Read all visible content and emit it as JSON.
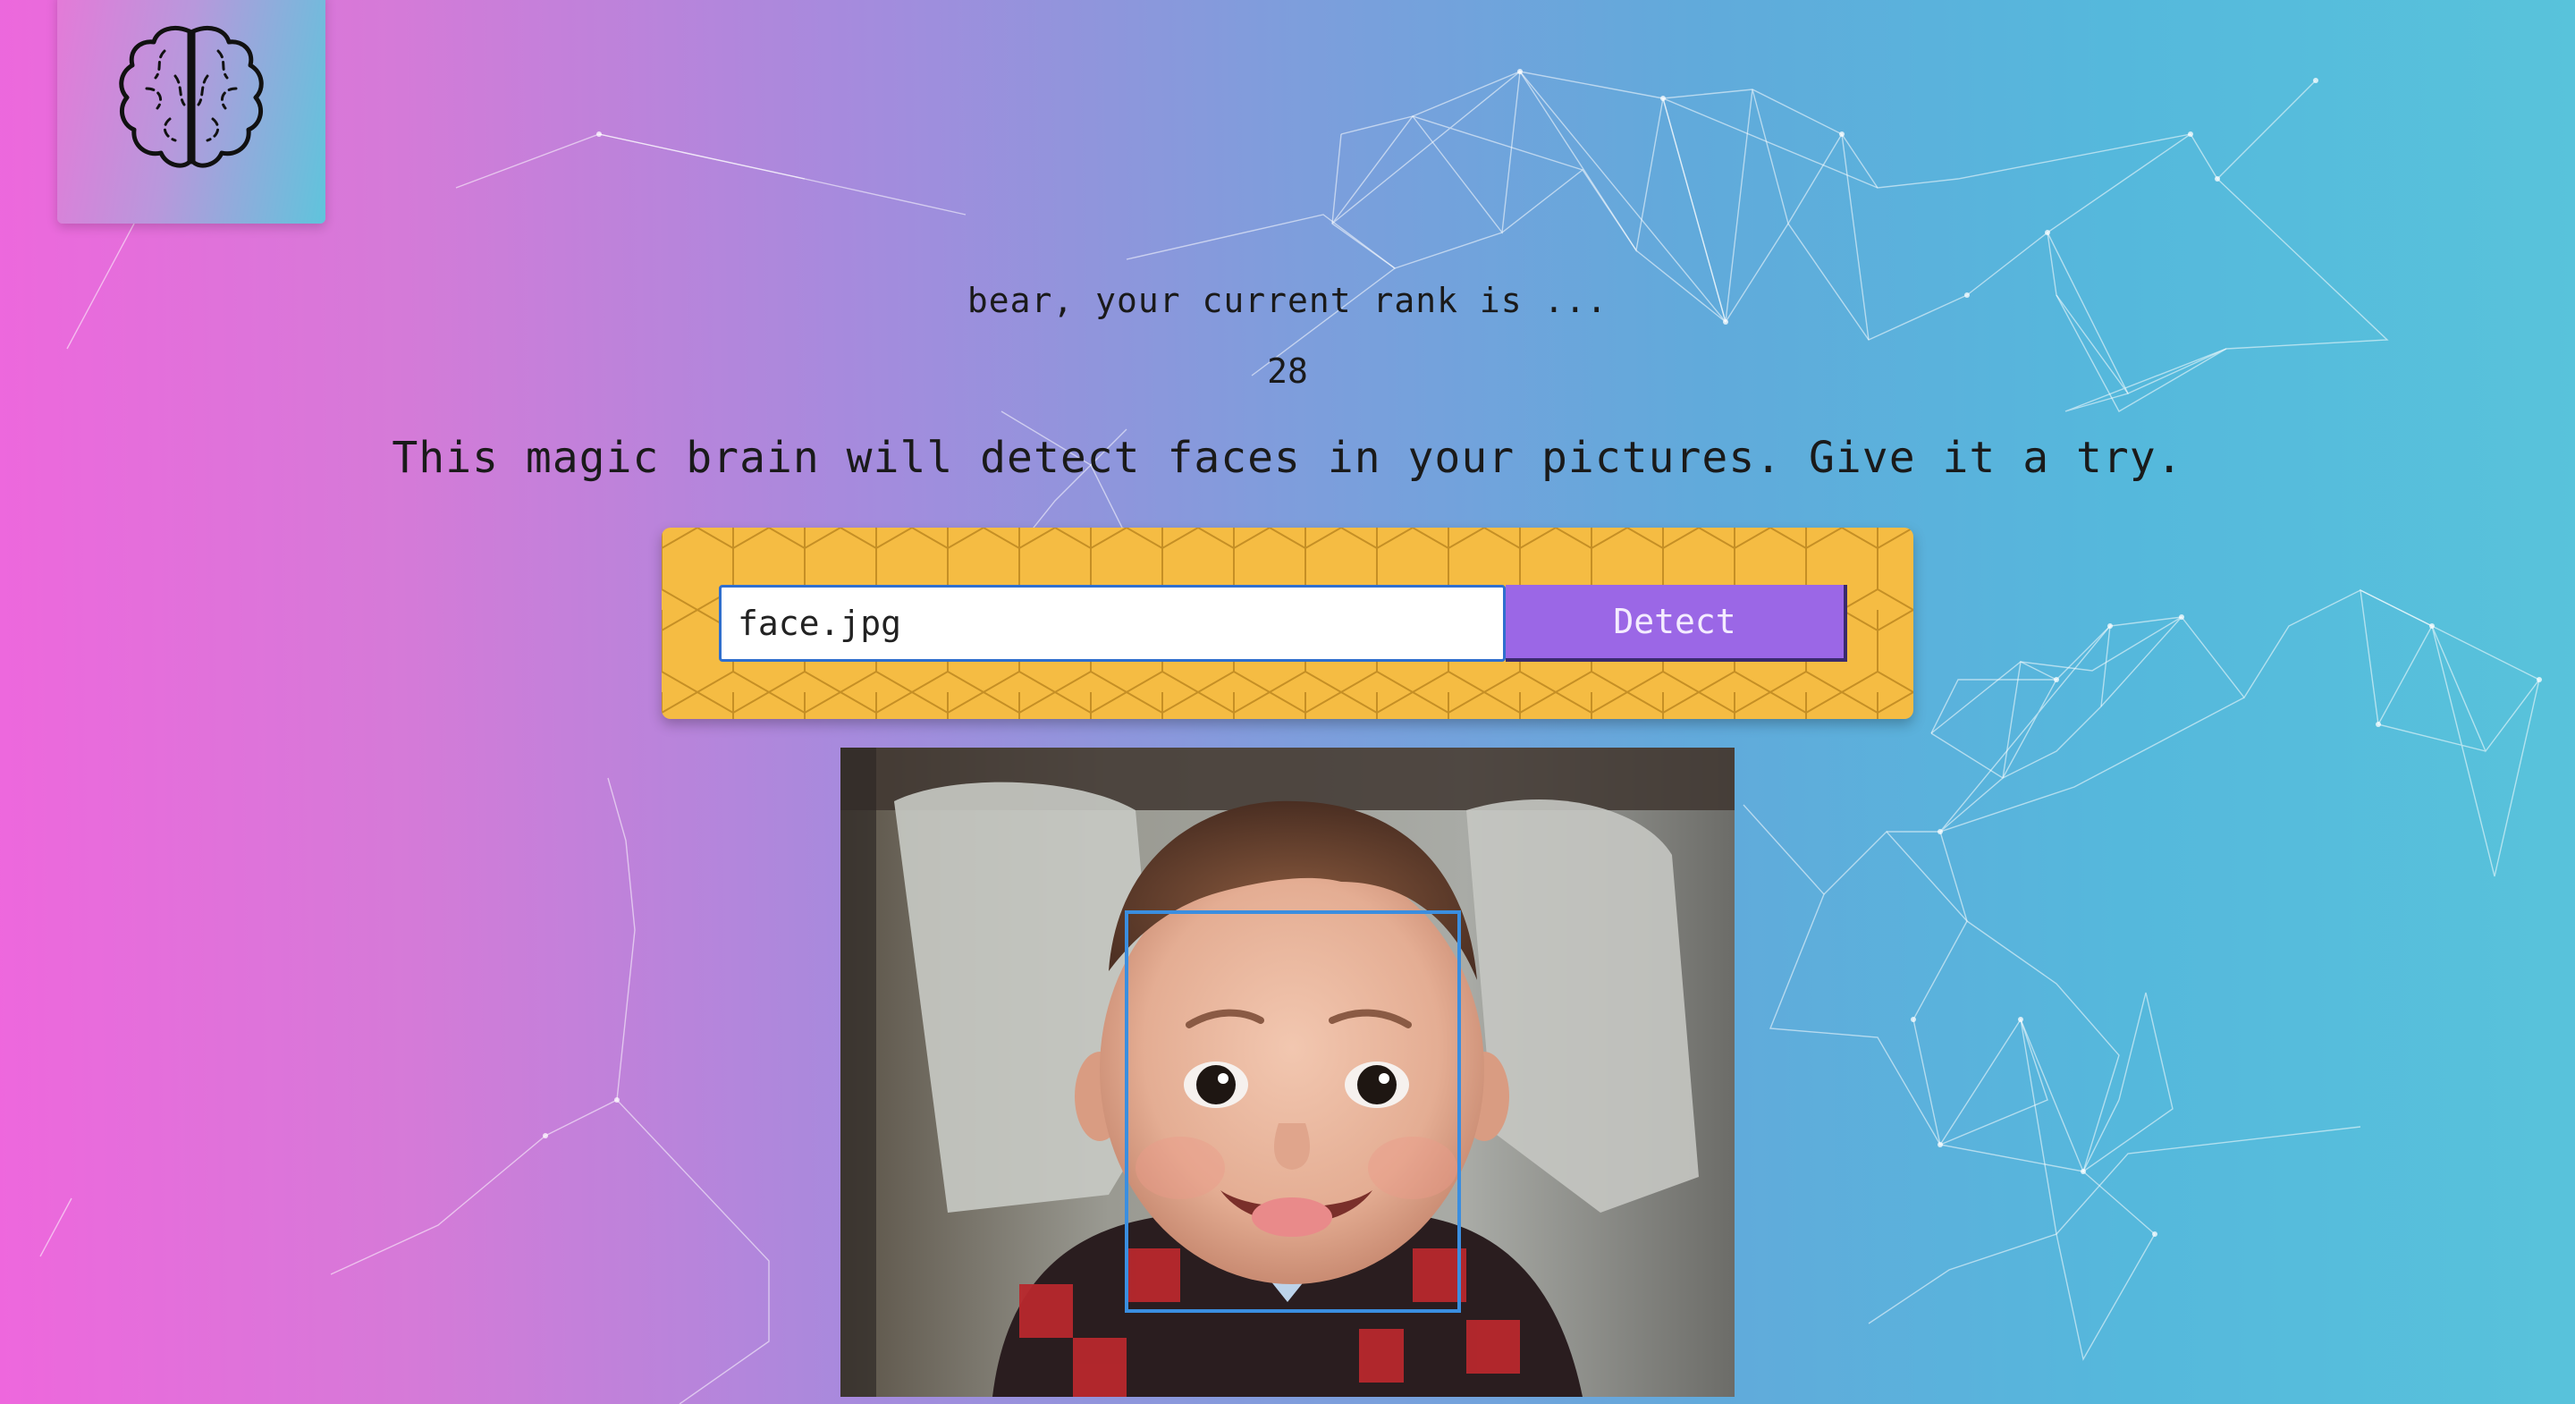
{
  "user": {
    "rank_message": "bear, your current rank is ...",
    "rank": "28"
  },
  "intro": {
    "text": "This magic brain will detect faces in your pictures. Give it a try."
  },
  "form": {
    "input_value": "face.jpg",
    "detect_label": "Detect"
  },
  "image": {
    "subject": "baby in red plaid jacket",
    "face_box_color": "#3a8ee0"
  },
  "logo": {
    "icon": "brain-icon"
  },
  "colors": {
    "gradient": [
      "#ee67dd",
      "#a78add",
      "#58c3db"
    ],
    "panel_bg": "#f5bc43",
    "detect_bg": "#9b67e6",
    "input_border": "#2f6fcf"
  }
}
